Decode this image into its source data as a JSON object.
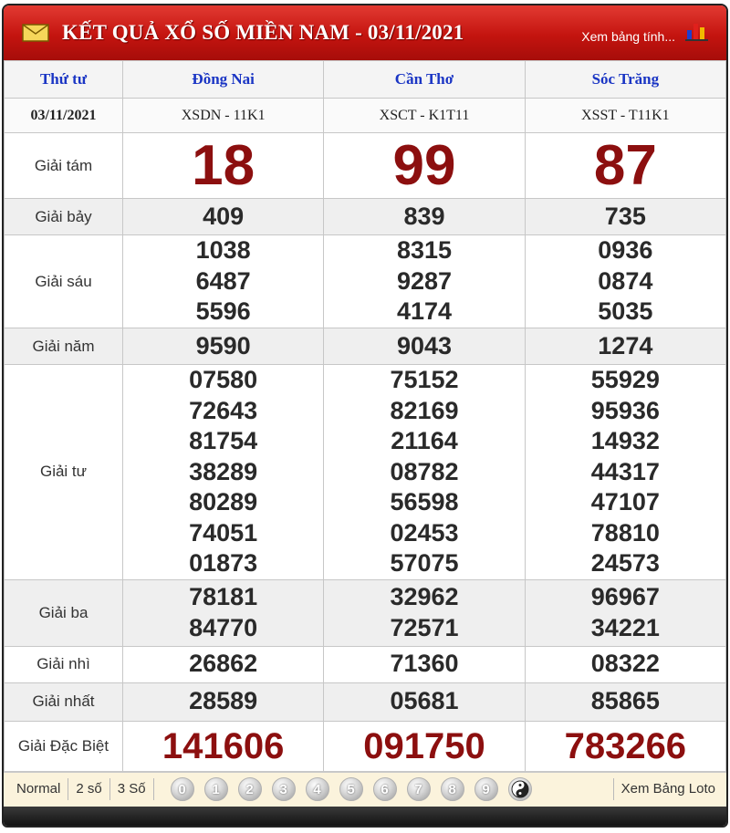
{
  "header": {
    "title": "KẾT QUẢ XỔ SỐ MIỀN NAM - 03/11/2021",
    "link": "Xem bảng tính...",
    "icons": [
      "envelope-icon",
      "bar-chart-icon"
    ]
  },
  "table": {
    "weekday": "Thứ tư",
    "date": "03/11/2021",
    "provinces": [
      {
        "name": "Đồng Nai",
        "code": "XSDN - 11K1"
      },
      {
        "name": "Cần Thơ",
        "code": "XSCT - K1T11"
      },
      {
        "name": "Sóc Trăng",
        "code": "XSST - T11K1"
      }
    ],
    "prizes": [
      {
        "label": "Giải tám",
        "values": [
          [
            "18"
          ],
          [
            "99"
          ],
          [
            "87"
          ]
        ]
      },
      {
        "label": "Giải bảy",
        "values": [
          [
            "409"
          ],
          [
            "839"
          ],
          [
            "735"
          ]
        ]
      },
      {
        "label": "Giải sáu",
        "values": [
          [
            "1038",
            "6487",
            "5596"
          ],
          [
            "8315",
            "9287",
            "4174"
          ],
          [
            "0936",
            "0874",
            "5035"
          ]
        ]
      },
      {
        "label": "Giải năm",
        "values": [
          [
            "9590"
          ],
          [
            "9043"
          ],
          [
            "1274"
          ]
        ]
      },
      {
        "label": "Giải tư",
        "values": [
          [
            "07580",
            "72643",
            "81754",
            "38289",
            "80289",
            "74051",
            "01873"
          ],
          [
            "75152",
            "82169",
            "21164",
            "08782",
            "56598",
            "02453",
            "57075"
          ],
          [
            "55929",
            "95936",
            "14932",
            "44317",
            "47107",
            "78810",
            "24573"
          ]
        ]
      },
      {
        "label": "Giải ba",
        "values": [
          [
            "78181",
            "84770"
          ],
          [
            "32962",
            "72571"
          ],
          [
            "96967",
            "34221"
          ]
        ]
      },
      {
        "label": "Giải nhì",
        "values": [
          [
            "26862"
          ],
          [
            "71360"
          ],
          [
            "08322"
          ]
        ]
      },
      {
        "label": "Giải nhất",
        "values": [
          [
            "28589"
          ],
          [
            "05681"
          ],
          [
            "85865"
          ]
        ]
      },
      {
        "label": "Giải Đặc Biệt",
        "values": [
          [
            "141606"
          ],
          [
            "091750"
          ],
          [
            "783266"
          ]
        ]
      }
    ]
  },
  "footer": {
    "tabs": [
      "Normal",
      "2 số",
      "3 Số"
    ],
    "digits": [
      "0",
      "1",
      "2",
      "3",
      "4",
      "5",
      "6",
      "7",
      "8",
      "9"
    ],
    "extra_icon": "yin-yang-icon",
    "loto_link": "Xem Bảng Loto"
  },
  "colors": {
    "header_red": "#c4140f",
    "prize_red": "#8c0f0f",
    "province_blue": "#1a35c4",
    "footer_bg": "#fbf3dc"
  }
}
